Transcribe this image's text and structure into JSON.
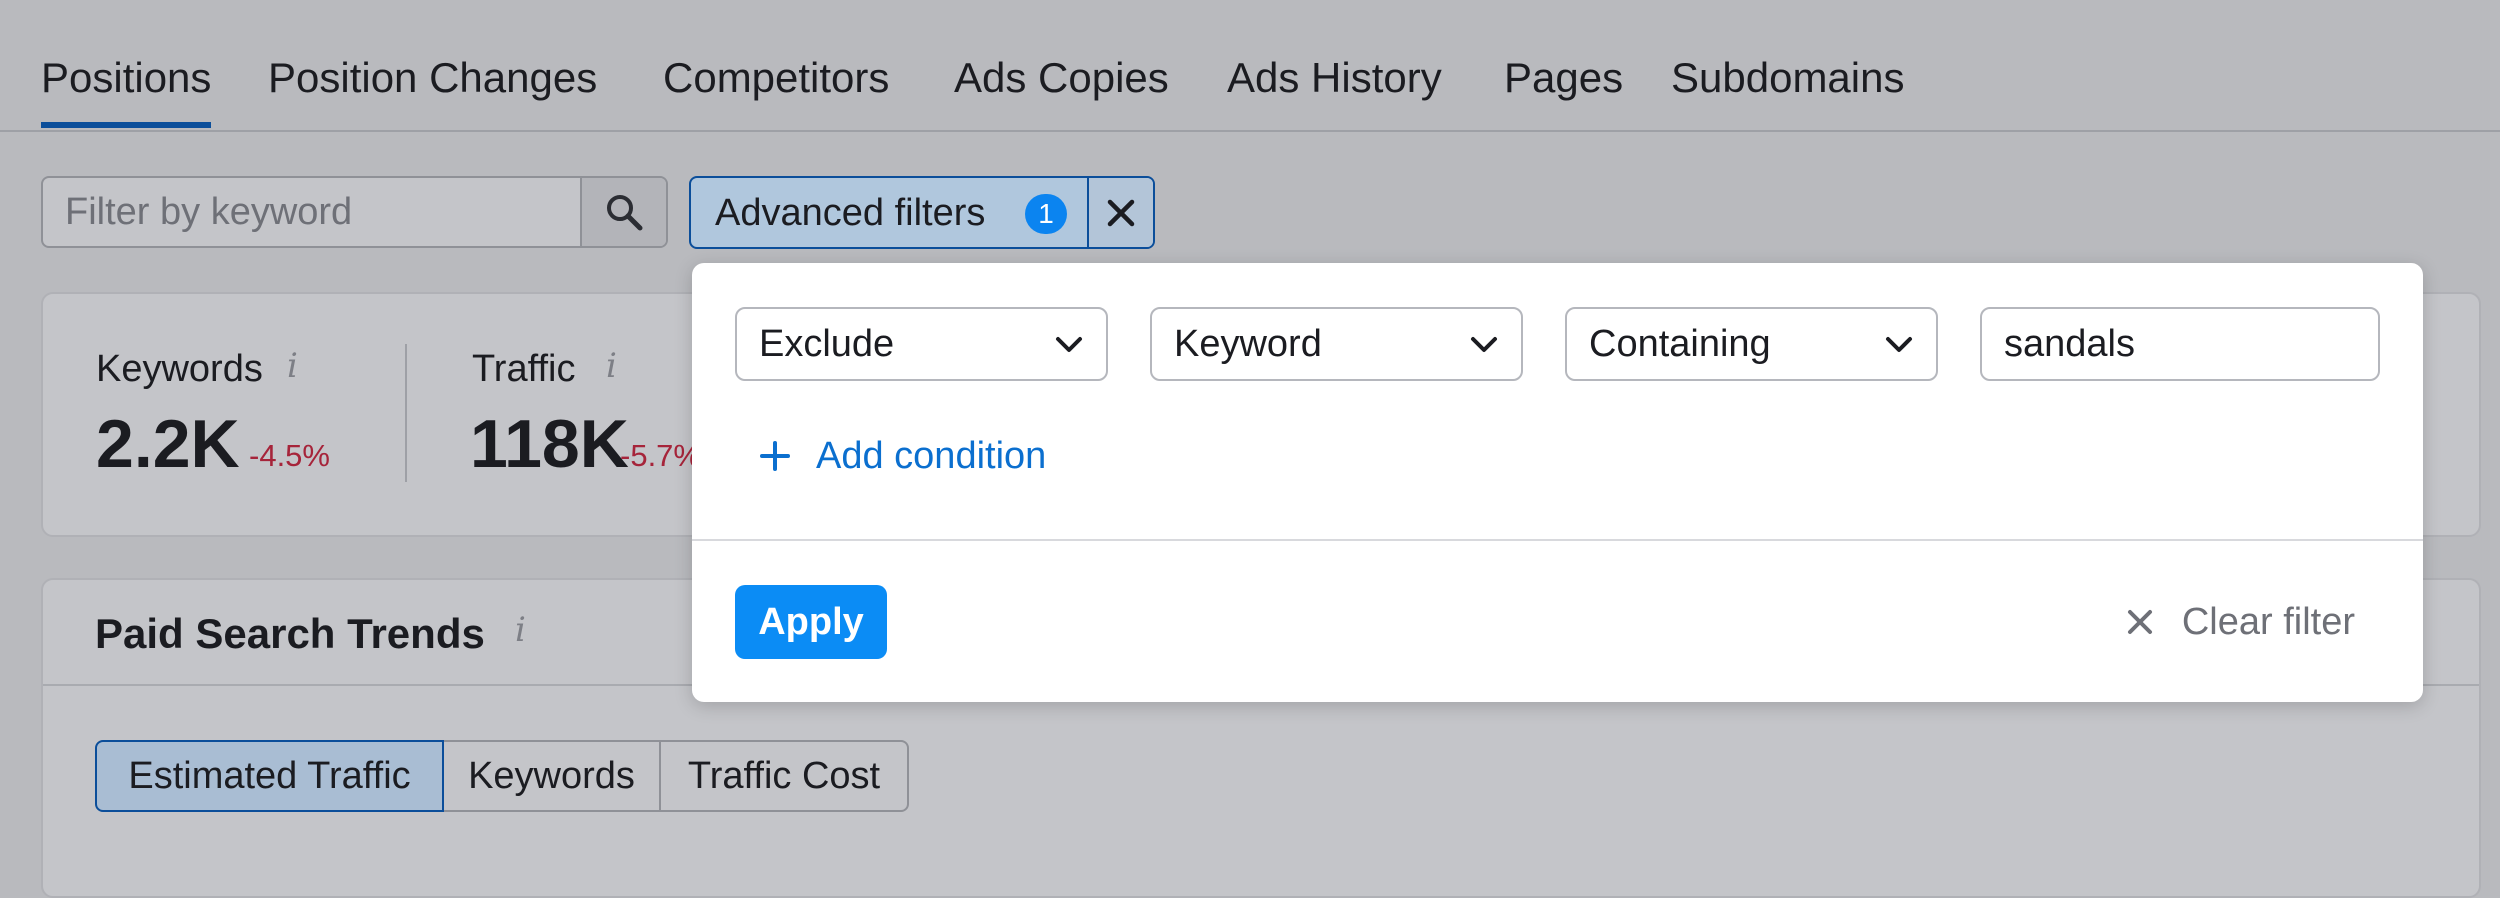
{
  "tabs": [
    {
      "label": "Positions",
      "active": true
    },
    {
      "label": "Position Changes",
      "active": false
    },
    {
      "label": "Competitors",
      "active": false
    },
    {
      "label": "Ads Copies",
      "active": false
    },
    {
      "label": "Ads History",
      "active": false
    },
    {
      "label": "Pages",
      "active": false
    },
    {
      "label": "Subdomains",
      "active": false
    }
  ],
  "search": {
    "placeholder": "Filter by keyword",
    "icon": "search-icon"
  },
  "advanced_filters": {
    "label": "Advanced filters",
    "count": "1",
    "close_icon": "close-icon"
  },
  "stats": {
    "info_glyph": "i",
    "keywords": {
      "label": "Keywords",
      "value": "2.2K",
      "delta": "-4.5%"
    },
    "traffic": {
      "label": "Traffic",
      "value": "118K",
      "delta": "-5.7%"
    }
  },
  "trends": {
    "title": "Paid Search Trends",
    "segments": [
      {
        "label": "Estimated Traffic",
        "active": true
      },
      {
        "label": "Keywords",
        "active": false
      },
      {
        "label": "Traffic Cost",
        "active": false
      }
    ]
  },
  "filter_popup": {
    "condition": {
      "action": "Exclude",
      "field": "Keyword",
      "operator": "Containing",
      "value": "sandals"
    },
    "add_condition_label": "Add condition",
    "apply_label": "Apply",
    "clear_label": "Clear filter"
  },
  "colors": {
    "accent": "#0b8cf5",
    "link": "#0b6fcf",
    "negative_delta": "#a6243a",
    "active_tab_underline": "#0b4e9a",
    "overlay_background": "#b9babe"
  }
}
